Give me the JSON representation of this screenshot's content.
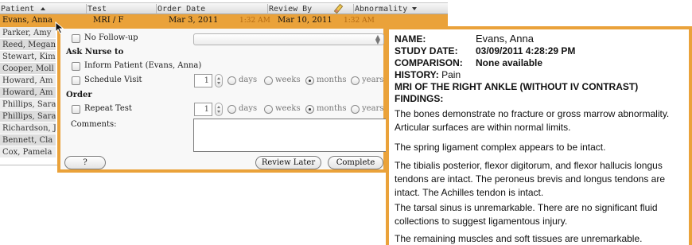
{
  "table": {
    "headers": {
      "patient": "Patient",
      "test": "Test",
      "order_date": "Order Date",
      "review_by": "Review By",
      "abnormality": "Abnormality"
    },
    "selected_row": {
      "patient": "Evans, Anna",
      "test": "MRI / F",
      "order_date": "Mar 3, 2011",
      "order_time": "1:32 AM",
      "review_by": "Mar 10, 2011",
      "review_time": "1:32 AM"
    },
    "rows": [
      "Parker, Amy",
      "Reed, Megan",
      "Stewart, Kim",
      "Cooper, Moll",
      "Howard, Am",
      "Howard, Am",
      "Phillips, Sara",
      "Phillips, Sara",
      "Richardson, J",
      "Bennett, Cla",
      "Cox, Pamela"
    ]
  },
  "dialog": {
    "no_followup": "No Follow-up",
    "ask_nurse": "Ask Nurse to",
    "inform_patient": "Inform Patient (Evans, Anna)",
    "schedule_visit": "Schedule Visit",
    "order": "Order",
    "repeat_test": "Repeat Test",
    "comments_label": "Comments:",
    "visit_count": "1",
    "repeat_count": "1",
    "units": {
      "days": "days",
      "weeks": "weeks",
      "months": "months",
      "years": "years"
    },
    "selected_unit": "months",
    "help_button": "?",
    "review_later_button": "Review Later",
    "complete_button": "Complete",
    "followup_select_value": ""
  },
  "report": {
    "name_label": "NAME:",
    "name_value": "Evans, Anna",
    "study_date_label": "STUDY DATE:",
    "study_date_value": "03/09/2011  4:28:29 PM",
    "comparison_label": "COMPARISON:",
    "comparison_value": "None available",
    "history_label": "HISTORY:",
    "history_value": "Pain",
    "exam_title": "MRI OF THE RIGHT ANKLE (WITHOUT IV CONTRAST)",
    "findings_label": "FINDINGS:",
    "paragraphs": [
      "The bones demonstrate no fracture or gross marrow abnormality. Articular surfaces are within normal limits.",
      "The spring ligament complex appears to be intact.",
      "The tibialis posterior, flexor digitorum, and flexor hallucis longus tendons are intact.  The peroneus brevis and longus tendons are intact.  The Achilles tendon is intact.",
      "The tarsal sinus is unremarkable.  There are no significant fluid collections to suggest ligamentous injury.",
      "The remaining muscles and soft tissues are unremarkable."
    ]
  },
  "colors": {
    "accent": "#eaa23a"
  },
  "icons": {
    "sort_ascending": "sort-up-icon",
    "sort_descending": "sort-down-icon",
    "edit": "pencil-icon",
    "cursor": "cursor-icon"
  }
}
